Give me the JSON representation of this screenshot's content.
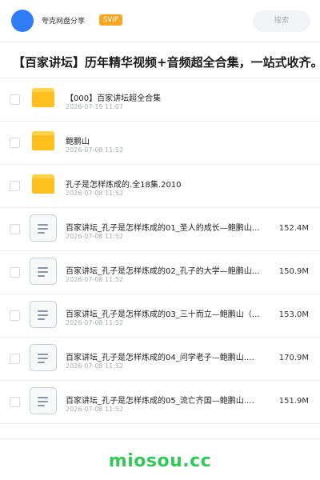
{
  "header": {
    "share_name": "夸克网盘分享",
    "badge": "SVIP",
    "search_placeholder": "搜索",
    "colors": {
      "avatar": "#2f7cf6",
      "badge": "#f5a623"
    }
  },
  "title": "【百家讲坛】历年精华视频+音频超全合集，一站式收齐。",
  "items": [
    {
      "type": "folder",
      "name": "【000】百家讲坛超全合集",
      "date": "2026-07-19 11:07",
      "size": ""
    },
    {
      "type": "folder",
      "name": "鲍鹏山",
      "date": "2026-07-08 11:52",
      "size": ""
    },
    {
      "type": "folder",
      "name": "孔子是怎样炼成的.全18集.2010",
      "date": "2026-07-08 11:52",
      "size": ""
    },
    {
      "type": "file",
      "name": "百家讲坛_孔子是怎样炼成的01_圣人的成长—鲍鹏山…",
      "date": "2026-07-08 11:52",
      "size": "152.4M"
    },
    {
      "type": "file",
      "name": "百家讲坛_孔子是怎样炼成的02_孔子的大学—鲍鹏山…",
      "date": "2026-07-08 11:52",
      "size": "150.9M"
    },
    {
      "type": "file",
      "name": "百家讲坛_孔子是怎样炼成的03_三十而立—鲍鹏山（…",
      "date": "2026-07-08 11:52",
      "size": "153.0M"
    },
    {
      "type": "file",
      "name": "百家讲坛_孔子是怎样炼成的04_问学老子—鲍鹏山.…",
      "date": "2026-07-08 11:52",
      "size": "170.9M"
    },
    {
      "type": "file",
      "name": "百家讲坛_孔子是怎样炼成的05_流亡齐国—鲍鹏山.…",
      "date": "2026-07-08 11:52",
      "size": "151.9M"
    }
  ],
  "watermark": "miosou.cc"
}
